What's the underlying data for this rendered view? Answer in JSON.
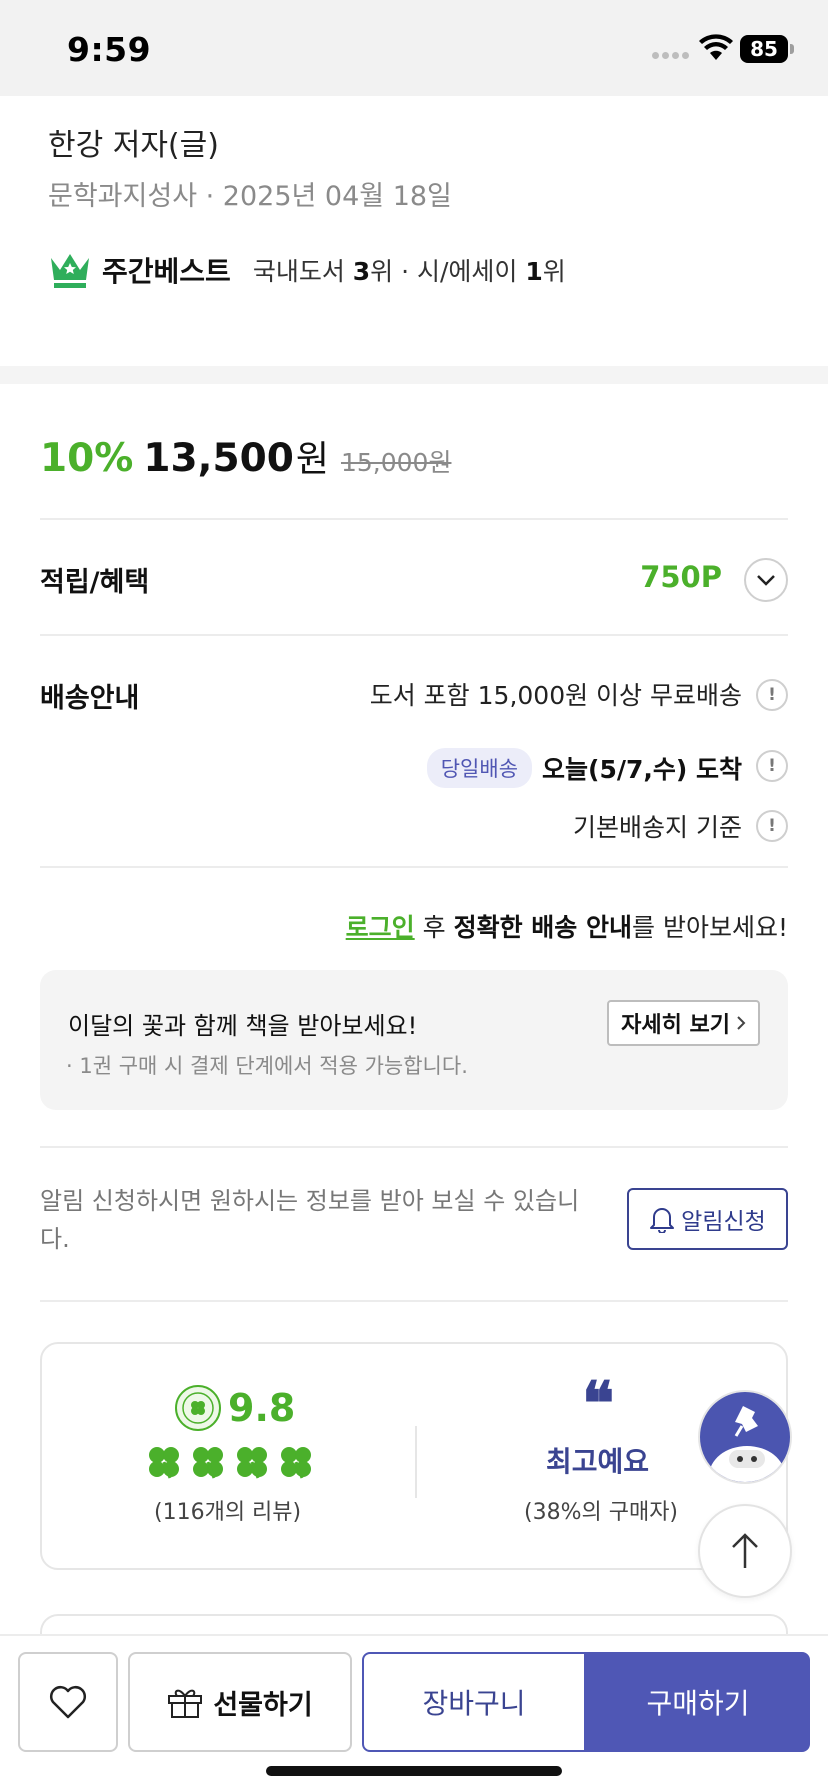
{
  "status_bar": {
    "time": "9:59",
    "battery": "85"
  },
  "book": {
    "author": "한강 저자(글)",
    "publisher_date": "문학과지성사 · 2025년 04월 18일"
  },
  "bestseller": {
    "label": "주간베스트",
    "rank1_prefix": "국내도서 ",
    "rank1_value": "3",
    "rank1_suffix": "위 · 시/에세이 ",
    "rank2_value": "1",
    "rank2_suffix": "위"
  },
  "price": {
    "discount": "10%",
    "sale_price": "13,500",
    "currency": "원",
    "original_price": "15,000원"
  },
  "points": {
    "label": "적립/혜택",
    "value": "750P"
  },
  "delivery": {
    "label": "배송안내",
    "free_shipping": "도서 포함 15,000원 이상 무료배송",
    "same_day_badge": "당일배송",
    "arrival": "오늘(5/7,수) 도착",
    "basis": "기본배송지 기준",
    "info_icon": "!"
  },
  "login_notice": {
    "link": "로그인",
    "middle": " 후 ",
    "bold": "정확한 배송 안내",
    "suffix": "를 받아보세요!"
  },
  "promo": {
    "title": "이달의 꽃과 함께 책을 받아보세요!",
    "subtitle": "· 1권 구매 시 결제 단계에서 적용 가능합니다.",
    "button": "자세히 보기"
  },
  "alert": {
    "text": "알림 신청하시면 원하시는 정보를 받아 보실 수 있습니다.",
    "button": "알림신청"
  },
  "review": {
    "score": "9.8",
    "rating_clovers": 4,
    "count": "(116개의 리뷰)",
    "best_label": "최고예요",
    "buyer_pct": "(38%의 구매자)"
  },
  "bottom_bar": {
    "gift": "선물하기",
    "cart": "장바구니",
    "buy": "구매하기"
  },
  "colors": {
    "accent_green": "#4bb02b",
    "brand_indigo": "#4f57b5",
    "text_indigo": "#3a4491"
  }
}
